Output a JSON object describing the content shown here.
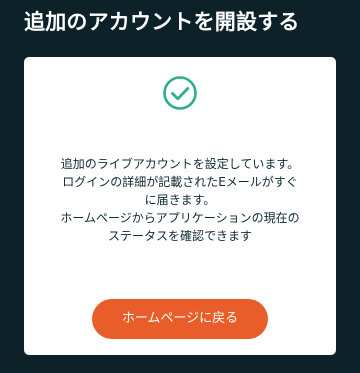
{
  "page": {
    "title": "追加のアカウントを開設する"
  },
  "colors": {
    "background": "#0d2228",
    "card": "#ffffff",
    "accent_green": "#2eae8c",
    "button_orange": "#e85d2a",
    "text_dark": "#0e2a36"
  },
  "card": {
    "status_icon": "check-circle-icon",
    "message_lines": [
      "追加のライブアカウントを設定しています。",
      "ログインの詳細が記載されたEメールがすぐ",
      "に届きます。",
      "ホームページからアプリケーションの現在の",
      "ステータスを確認できます"
    ],
    "button_label": "ホームページに戻る"
  }
}
